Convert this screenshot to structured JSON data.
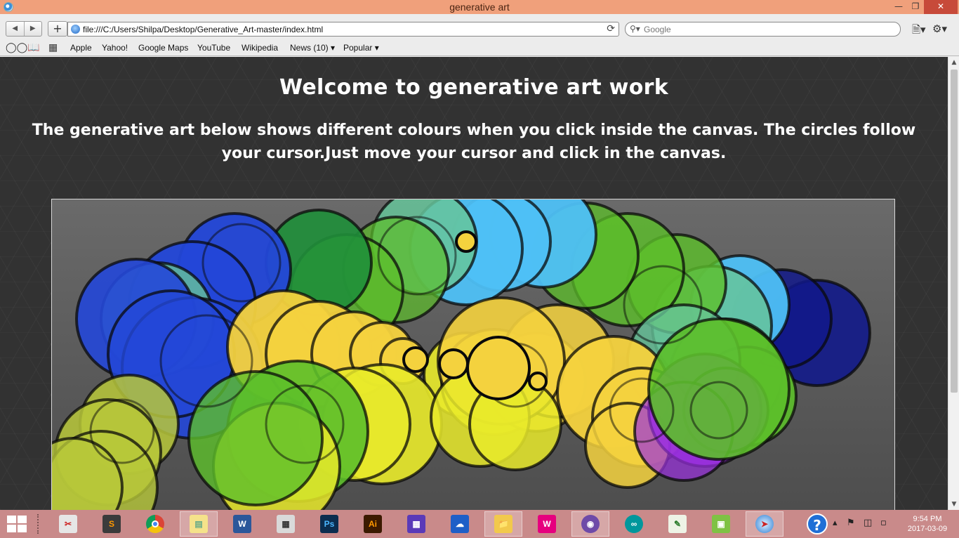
{
  "window": {
    "title": "generative art"
  },
  "toolbar": {
    "url": "file:///C:/Users/Shilpa/Desktop/Generative_Art-master/index.html",
    "search_placeholder": "Google"
  },
  "bookmarks": {
    "items": [
      {
        "label": "Apple"
      },
      {
        "label": "Yahoo!"
      },
      {
        "label": "Google Maps"
      },
      {
        "label": "YouTube"
      },
      {
        "label": "Wikipedia"
      },
      {
        "label": "News (10) ▾"
      },
      {
        "label": "Popular ▾"
      }
    ]
  },
  "page": {
    "heading": "Welcome to generative art work",
    "description": "The generative art below shows different colours when you click inside the canvas. The circles follow your cursor.Just move your cursor and click in the canvas."
  },
  "artwork": {
    "palette": {
      "blue": "#2347d8",
      "navy": "#12198a",
      "sky": "#4ec0f6",
      "green": "#5cbf2a",
      "darkgreen": "#1f8f3a",
      "teal": "#66c49a",
      "yellow": "#f4d23e",
      "lemon": "#e9ea2a",
      "olive": "#b8c83a",
      "purple": "#9a2fe0",
      "outline": "#0a0a0a"
    }
  },
  "taskbar": {
    "clock_time": "9:54 PM",
    "clock_date": "2017-03-09",
    "apps": [
      "snipping-tool-icon",
      "sublime-text-icon",
      "chrome-icon",
      "photos-icon",
      "word-icon",
      "calculator-icon",
      "photoshop-icon",
      "illustrator-icon",
      "calendar-icon",
      "onedrive-icon",
      "file-explorer-icon",
      "wamp-icon",
      "github-icon",
      "arduino-icon",
      "notepad-icon",
      "remote-icon",
      "safari-icon"
    ]
  }
}
